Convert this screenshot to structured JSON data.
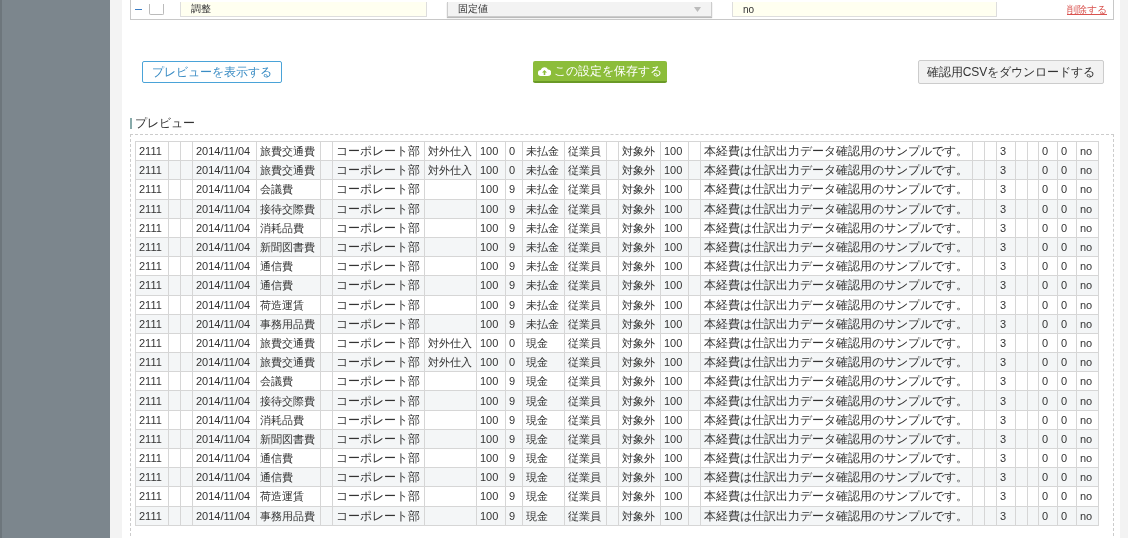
{
  "mapping_row": {
    "expanded": true,
    "checked": false,
    "name": "調整",
    "source": "固定値",
    "value": "no",
    "delete_link": "削除する"
  },
  "buttons": {
    "preview": "プレビューを表示する",
    "save": "この設定を保存する",
    "download": "確認用CSVをダウンロードする"
  },
  "preview": {
    "title": "プレビュー",
    "rows": [
      {
        "code": "2111",
        "date": "2014/11/04",
        "account": "旅費交通費",
        "department": "コーポレート部",
        "tax_category": "対外仕入",
        "amount": "100",
        "tax_rate": "0",
        "payment": "未払金",
        "payee": "従業員",
        "tax_status": "対象外",
        "amount_2": "100",
        "description": "本経費は仕訳出力データ確認用のサンプルです。",
        "count": "3",
        "column_23": "0",
        "column_24": "0",
        "flag": "no"
      },
      {
        "code": "2111",
        "date": "2014/11/04",
        "account": "旅費交通費",
        "department": "コーポレート部",
        "tax_category": "対外仕入",
        "amount": "100",
        "tax_rate": "0",
        "payment": "未払金",
        "payee": "従業員",
        "tax_status": "対象外",
        "amount_2": "100",
        "description": "本経費は仕訳出力データ確認用のサンプルです。",
        "count": "3",
        "column_23": "0",
        "column_24": "0",
        "flag": "no"
      },
      {
        "code": "2111",
        "date": "2014/11/04",
        "account": "会議費",
        "department": "コーポレート部",
        "amount": "100",
        "tax_rate": "9",
        "payment": "未払金",
        "payee": "従業員",
        "tax_status": "対象外",
        "amount_2": "100",
        "description": "本経費は仕訳出力データ確認用のサンプルです。",
        "count": "3",
        "column_23": "0",
        "column_24": "0",
        "flag": "no"
      },
      {
        "code": "2111",
        "date": "2014/11/04",
        "account": "接待交際費",
        "department": "コーポレート部",
        "amount": "100",
        "tax_rate": "9",
        "payment": "未払金",
        "payee": "従業員",
        "tax_status": "対象外",
        "amount_2": "100",
        "description": "本経費は仕訳出力データ確認用のサンプルです。",
        "count": "3",
        "column_23": "0",
        "column_24": "0",
        "flag": "no"
      },
      {
        "code": "2111",
        "date": "2014/11/04",
        "account": "消耗品費",
        "department": "コーポレート部",
        "amount": "100",
        "tax_rate": "9",
        "payment": "未払金",
        "payee": "従業員",
        "tax_status": "対象外",
        "amount_2": "100",
        "description": "本経費は仕訳出力データ確認用のサンプルです。",
        "count": "3",
        "column_23": "0",
        "column_24": "0",
        "flag": "no"
      },
      {
        "code": "2111",
        "date": "2014/11/04",
        "account": "新聞図書費",
        "department": "コーポレート部",
        "amount": "100",
        "tax_rate": "9",
        "payment": "未払金",
        "payee": "従業員",
        "tax_status": "対象外",
        "amount_2": "100",
        "description": "本経費は仕訳出力データ確認用のサンプルです。",
        "count": "3",
        "column_23": "0",
        "column_24": "0",
        "flag": "no"
      },
      {
        "code": "2111",
        "date": "2014/11/04",
        "account": "通信費",
        "department": "コーポレート部",
        "amount": "100",
        "tax_rate": "9",
        "payment": "未払金",
        "payee": "従業員",
        "tax_status": "対象外",
        "amount_2": "100",
        "description": "本経費は仕訳出力データ確認用のサンプルです。",
        "count": "3",
        "column_23": "0",
        "column_24": "0",
        "flag": "no"
      },
      {
        "code": "2111",
        "date": "2014/11/04",
        "account": "通信費",
        "department": "コーポレート部",
        "amount": "100",
        "tax_rate": "9",
        "payment": "未払金",
        "payee": "従業員",
        "tax_status": "対象外",
        "amount_2": "100",
        "description": "本経費は仕訳出力データ確認用のサンプルです。",
        "count": "3",
        "column_23": "0",
        "column_24": "0",
        "flag": "no"
      },
      {
        "code": "2111",
        "date": "2014/11/04",
        "account": "荷造運賃",
        "department": "コーポレート部",
        "amount": "100",
        "tax_rate": "9",
        "payment": "未払金",
        "payee": "従業員",
        "tax_status": "対象外",
        "amount_2": "100",
        "description": "本経費は仕訳出力データ確認用のサンプルです。",
        "count": "3",
        "column_23": "0",
        "column_24": "0",
        "flag": "no"
      },
      {
        "code": "2111",
        "date": "2014/11/04",
        "account": "事務用品費",
        "department": "コーポレート部",
        "amount": "100",
        "tax_rate": "9",
        "payment": "未払金",
        "payee": "従業員",
        "tax_status": "対象外",
        "amount_2": "100",
        "description": "本経費は仕訳出力データ確認用のサンプルです。",
        "count": "3",
        "column_23": "0",
        "column_24": "0",
        "flag": "no"
      },
      {
        "code": "2111",
        "date": "2014/11/04",
        "account": "旅費交通費",
        "department": "コーポレート部",
        "tax_category": "対外仕入",
        "amount": "100",
        "tax_rate": "0",
        "payment": "現金",
        "payee": "従業員",
        "tax_status": "対象外",
        "amount_2": "100",
        "description": "本経費は仕訳出力データ確認用のサンプルです。",
        "count": "3",
        "column_23": "0",
        "column_24": "0",
        "flag": "no"
      },
      {
        "code": "2111",
        "date": "2014/11/04",
        "account": "旅費交通費",
        "department": "コーポレート部",
        "tax_category": "対外仕入",
        "amount": "100",
        "tax_rate": "0",
        "payment": "現金",
        "payee": "従業員",
        "tax_status": "対象外",
        "amount_2": "100",
        "description": "本経費は仕訳出力データ確認用のサンプルです。",
        "count": "3",
        "column_23": "0",
        "column_24": "0",
        "flag": "no"
      },
      {
        "code": "2111",
        "date": "2014/11/04",
        "account": "会議費",
        "department": "コーポレート部",
        "amount": "100",
        "tax_rate": "9",
        "payment": "現金",
        "payee": "従業員",
        "tax_status": "対象外",
        "amount_2": "100",
        "description": "本経費は仕訳出力データ確認用のサンプルです。",
        "count": "3",
        "column_23": "0",
        "column_24": "0",
        "flag": "no"
      },
      {
        "code": "2111",
        "date": "2014/11/04",
        "account": "接待交際費",
        "department": "コーポレート部",
        "amount": "100",
        "tax_rate": "9",
        "payment": "現金",
        "payee": "従業員",
        "tax_status": "対象外",
        "amount_2": "100",
        "description": "本経費は仕訳出力データ確認用のサンプルです。",
        "count": "3",
        "column_23": "0",
        "column_24": "0",
        "flag": "no"
      },
      {
        "code": "2111",
        "date": "2014/11/04",
        "account": "消耗品費",
        "department": "コーポレート部",
        "amount": "100",
        "tax_rate": "9",
        "payment": "現金",
        "payee": "従業員",
        "tax_status": "対象外",
        "amount_2": "100",
        "description": "本経費は仕訳出力データ確認用のサンプルです。",
        "count": "3",
        "column_23": "0",
        "column_24": "0",
        "flag": "no"
      },
      {
        "code": "2111",
        "date": "2014/11/04",
        "account": "新聞図書費",
        "department": "コーポレート部",
        "amount": "100",
        "tax_rate": "9",
        "payment": "現金",
        "payee": "従業員",
        "tax_status": "対象外",
        "amount_2": "100",
        "description": "本経費は仕訳出力データ確認用のサンプルです。",
        "count": "3",
        "column_23": "0",
        "column_24": "0",
        "flag": "no"
      },
      {
        "code": "2111",
        "date": "2014/11/04",
        "account": "通信費",
        "department": "コーポレート部",
        "amount": "100",
        "tax_rate": "9",
        "payment": "現金",
        "payee": "従業員",
        "tax_status": "対象外",
        "amount_2": "100",
        "description": "本経費は仕訳出力データ確認用のサンプルです。",
        "count": "3",
        "column_23": "0",
        "column_24": "0",
        "flag": "no"
      },
      {
        "code": "2111",
        "date": "2014/11/04",
        "account": "通信費",
        "department": "コーポレート部",
        "amount": "100",
        "tax_rate": "9",
        "payment": "現金",
        "payee": "従業員",
        "tax_status": "対象外",
        "amount_2": "100",
        "description": "本経費は仕訳出力データ確認用のサンプルです。",
        "count": "3",
        "column_23": "0",
        "column_24": "0",
        "flag": "no"
      },
      {
        "code": "2111",
        "date": "2014/11/04",
        "account": "荷造運賃",
        "department": "コーポレート部",
        "amount": "100",
        "tax_rate": "9",
        "payment": "現金",
        "payee": "従業員",
        "tax_status": "対象外",
        "amount_2": "100",
        "description": "本経費は仕訳出力データ確認用のサンプルです。",
        "count": "3",
        "column_23": "0",
        "column_24": "0",
        "flag": "no"
      },
      {
        "code": "2111",
        "date": "2014/11/04",
        "account": "事務用品費",
        "department": "コーポレート部",
        "amount": "100",
        "tax_rate": "9",
        "payment": "現金",
        "payee": "従業員",
        "tax_status": "対象外",
        "amount_2": "100",
        "description": "本経費は仕訳出力データ確認用のサンプルです。",
        "count": "3",
        "column_23": "0",
        "column_24": "0",
        "flag": "no"
      }
    ]
  }
}
